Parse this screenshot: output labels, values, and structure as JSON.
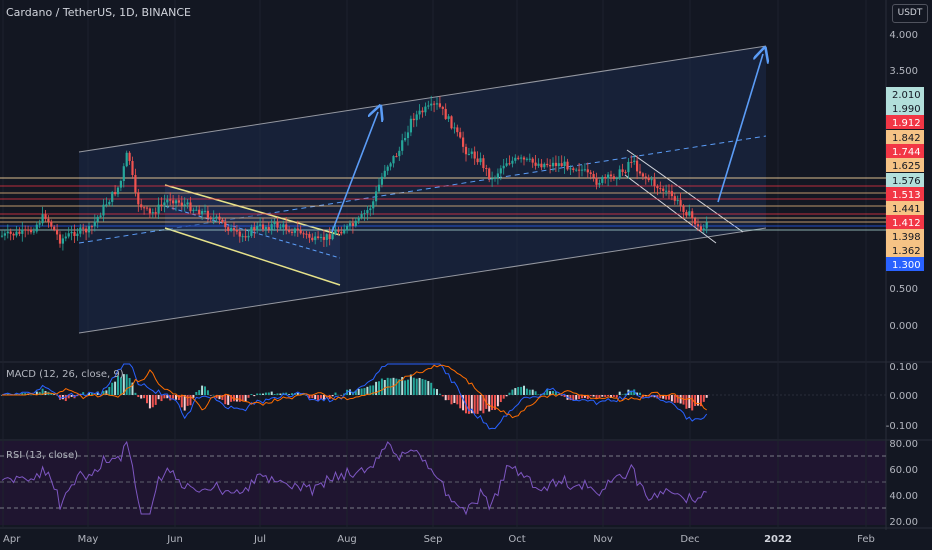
{
  "header": {
    "title": "Cardano / TetherUS, 1D, BINANCE",
    "currency_button": "USDT"
  },
  "price_axis": {
    "ticks": [
      "4.000",
      "3.500",
      "0.500",
      "0.000"
    ]
  },
  "price_levels": [
    {
      "label": "2.010",
      "bg": "#b2dfdb",
      "fg": "#131722"
    },
    {
      "label": "1.990",
      "bg": "#b2dfdb",
      "fg": "#131722"
    },
    {
      "label": "1.912",
      "bg": "#f23645",
      "fg": "#ffffff"
    },
    {
      "label": "1.842",
      "bg": "#f6c385",
      "fg": "#131722"
    },
    {
      "label": "1.744",
      "bg": "#f23645",
      "fg": "#ffffff"
    },
    {
      "label": "1.625",
      "bg": "#f6c385",
      "fg": "#131722"
    },
    {
      "label": "1.576",
      "bg": "#b2dfdb",
      "fg": "#131722"
    },
    {
      "label": "1.513",
      "bg": "#f23645",
      "fg": "#ffffff"
    },
    {
      "label": "1.441",
      "bg": "#f6c385",
      "fg": "#131722"
    },
    {
      "label": "1.412",
      "bg": "#f23645",
      "fg": "#ffffff"
    },
    {
      "label": "1.398",
      "bg": "#f6c385",
      "fg": "#131722"
    },
    {
      "label": "1.362",
      "bg": "#f6c385",
      "fg": "#131722"
    },
    {
      "label": "1.300",
      "bg": "#2962ff",
      "fg": "#ffffff"
    }
  ],
  "macd": {
    "label": "MACD (12, 26, close, 9)",
    "ticks": [
      "0.100",
      "0.000",
      "-0.100"
    ]
  },
  "rsi": {
    "label": "RSI (13, close)",
    "ticks": [
      "80.00",
      "60.00",
      "40.00",
      "20.00"
    ]
  },
  "time_axis": {
    "ticks": [
      "Apr",
      "May",
      "Jun",
      "Jul",
      "Aug",
      "Sep",
      "Oct",
      "Nov",
      "Dec",
      "2022",
      "Feb"
    ]
  },
  "colors": {
    "background": "#131722",
    "up": "#26a69a",
    "down": "#ef5350",
    "grid": "#1e222d",
    "channel": "#9598a1",
    "arrow": "#5b9cf6"
  }
}
